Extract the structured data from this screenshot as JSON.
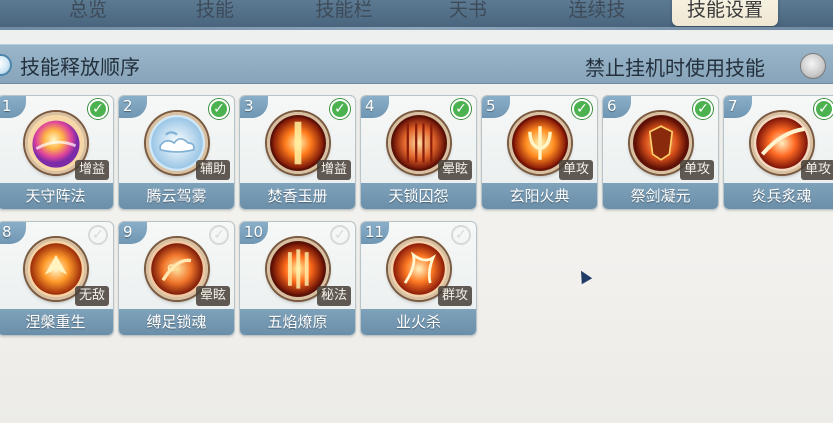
{
  "tabs": [
    {
      "label": "总览",
      "active": false
    },
    {
      "label": "技能",
      "active": false
    },
    {
      "label": "技能栏",
      "active": false
    },
    {
      "label": "天书",
      "active": false
    },
    {
      "label": "连续技",
      "active": false
    },
    {
      "label": "技能设置",
      "active": true
    }
  ],
  "section": {
    "title": "技能释放顺序",
    "right_label": "禁止挂机时使用技能",
    "toggle_on": false
  },
  "skills": [
    {
      "num": "1",
      "name": "天守阵法",
      "tag": "增益",
      "checked": true,
      "icon": "rainbow-orb-icon"
    },
    {
      "num": "2",
      "name": "腾云驾雾",
      "tag": "辅助",
      "checked": true,
      "icon": "cloud-icon"
    },
    {
      "num": "3",
      "name": "焚香玉册",
      "tag": "增益",
      "checked": true,
      "icon": "flame-pillar-icon"
    },
    {
      "num": "4",
      "name": "天锁囚怨",
      "tag": "晕眩",
      "checked": true,
      "icon": "chains-icon"
    },
    {
      "num": "5",
      "name": "玄阳火典",
      "tag": "单攻",
      "checked": true,
      "icon": "trident-fire-icon"
    },
    {
      "num": "6",
      "name": "祭剑凝元",
      "tag": "单攻",
      "checked": true,
      "icon": "beast-mask-icon"
    },
    {
      "num": "7",
      "name": "炎兵炙魂",
      "tag": "单攻",
      "checked": true,
      "icon": "fire-slash-icon"
    },
    {
      "num": "8",
      "name": "涅槃重生",
      "tag": "无敌",
      "checked": false,
      "icon": "phoenix-icon"
    },
    {
      "num": "9",
      "name": "缚足锁魂",
      "tag": "晕眩",
      "checked": false,
      "icon": "fire-chain-icon"
    },
    {
      "num": "10",
      "name": "五焰燎原",
      "tag": "秘法",
      "checked": false,
      "icon": "fire-pillars-icon"
    },
    {
      "num": "11",
      "name": "业火杀",
      "tag": "群攻",
      "checked": false,
      "icon": "dragon-fire-icon"
    }
  ],
  "colors": {
    "tabbar": "#4f6b85",
    "section": "#8fabc0",
    "name_bar": "#7497b1",
    "check_on": "#4bb24f"
  }
}
